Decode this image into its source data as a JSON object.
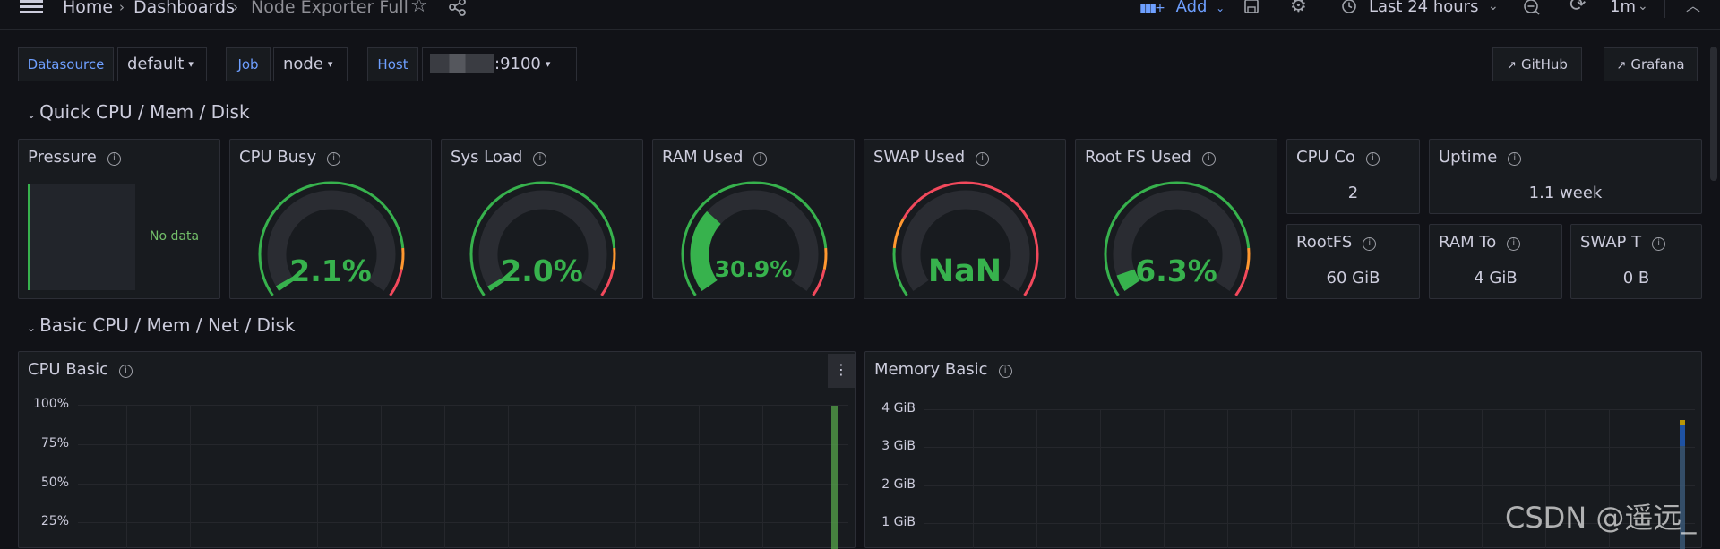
{
  "topbar": {
    "breadcrumb": [
      "Home",
      "Dashboards",
      "Node Exporter Full"
    ],
    "add_label": "Add",
    "time_range": "Last 24 hours",
    "refresh_interval": "1m"
  },
  "variables": [
    {
      "label": "Datasource",
      "value": "default"
    },
    {
      "label": "Job",
      "value": "node"
    },
    {
      "label": "Host",
      "value": ":9100"
    }
  ],
  "links": [
    "GitHub",
    "Grafana"
  ],
  "rows": [
    "Quick CPU / Mem / Disk",
    "Basic CPU / Mem / Net / Disk"
  ],
  "panels": {
    "pressure": {
      "title": "Pressure",
      "no_data": "No data"
    },
    "gauges": [
      {
        "title": "CPU Busy",
        "value": "2.1%",
        "fraction": 0.021
      },
      {
        "title": "Sys Load",
        "value": "2.0%",
        "fraction": 0.02
      },
      {
        "title": "RAM Used",
        "value": "30.9%",
        "fraction": 0.309
      },
      {
        "title": "SWAP Used",
        "value": "NaN",
        "fraction": 0
      },
      {
        "title": "Root FS Used",
        "value": "6.3%",
        "fraction": 0.063
      }
    ],
    "stats": [
      {
        "title": "CPU Co",
        "value": "2"
      },
      {
        "title": "Uptime",
        "value": "1.1 week"
      },
      {
        "title": "RootFS",
        "value": "60 GiB"
      },
      {
        "title": "RAM To",
        "value": "4 GiB"
      },
      {
        "title": "SWAP T",
        "value": "0 B"
      }
    ],
    "cpu_basic": {
      "title": "CPU Basic",
      "yticks": [
        "100%",
        "75%",
        "50%",
        "25%"
      ]
    },
    "memory_basic": {
      "title": "Memory Basic",
      "yticks": [
        "4 GiB",
        "3 GiB",
        "2 GiB",
        "1 GiB"
      ]
    }
  },
  "watermark": "CSDN @遥远_",
  "colors": {
    "green": "#37b24d",
    "orange": "#ff9830",
    "red": "#f2495c",
    "link_blue": "#6e9fff",
    "background": "#111217",
    "panel": "#181b1f"
  },
  "chart_data": [
    {
      "type": "line",
      "title": "CPU Basic",
      "ylim": [
        0,
        100
      ],
      "yticks": [
        "100%",
        "75%",
        "50%",
        "25%"
      ],
      "series": []
    },
    {
      "type": "line",
      "title": "Memory Basic",
      "ylim": [
        0,
        4
      ],
      "yticks": [
        "4 GiB",
        "3 GiB",
        "2 GiB",
        "1 GiB"
      ],
      "series": []
    }
  ]
}
